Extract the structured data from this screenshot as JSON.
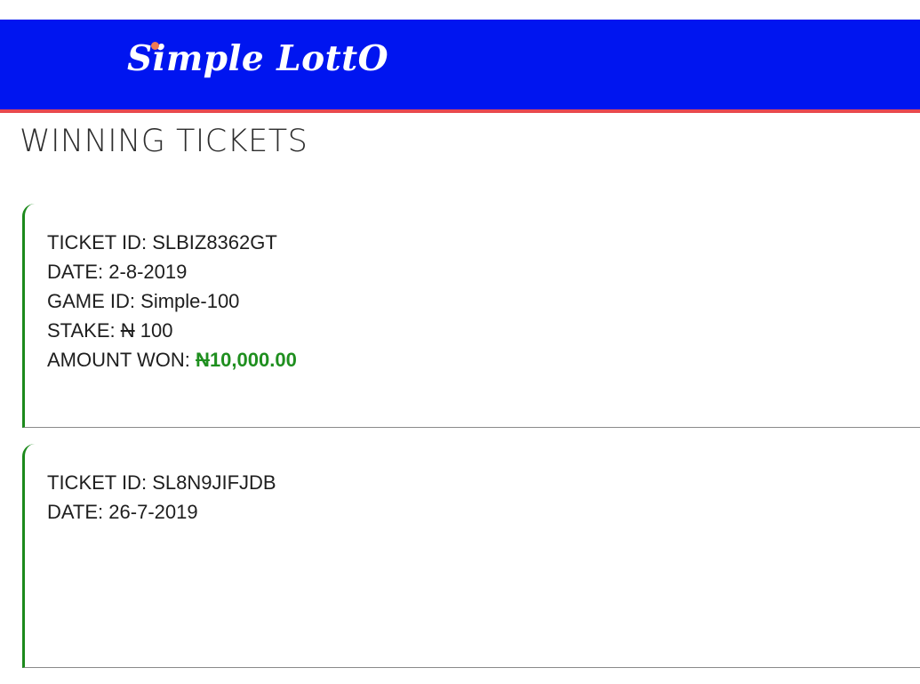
{
  "header": {
    "logo_text": "Simple LottO",
    "brand_color": "#0015f0",
    "accent_color": "#e8494f"
  },
  "page": {
    "title": "WINNING TICKETS"
  },
  "tickets": [
    {
      "id_label": "TICKET ID:",
      "id_value": "SLBIZ8362GT",
      "date_label": "DATE:",
      "date_value": "2-8-2019",
      "game_label": "GAME ID:",
      "game_value": "Simple-100",
      "stake_label": "STAKE:",
      "stake_currency": "N",
      "stake_value": "100",
      "won_label": "AMOUNT WON:",
      "won_currency": "N",
      "won_value": "10,000.00"
    },
    {
      "id_label": "TICKET ID:",
      "id_value": "SL8N9JIFJDB",
      "date_label": "DATE:",
      "date_value": "26-7-2019"
    }
  ],
  "colors": {
    "ticket_border": "#1c8a1c",
    "won_text": "#1f8f1f"
  }
}
